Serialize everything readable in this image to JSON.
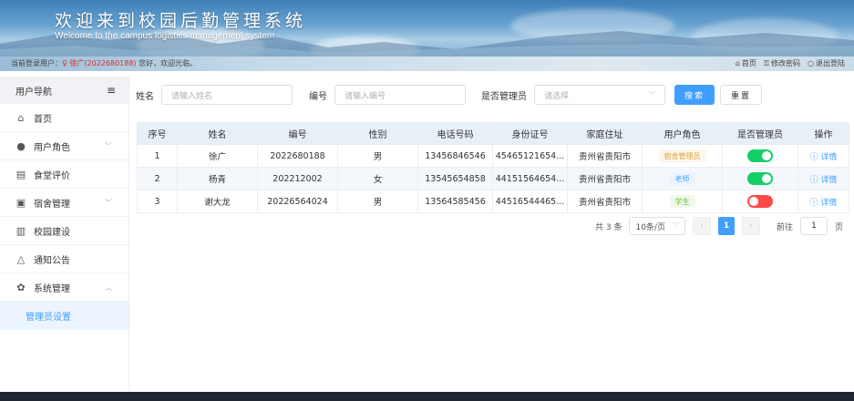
{
  "header": {
    "title": "欢迎来到校园后勤管理系统",
    "subtitle": "Welcome to the campus logistics management system"
  },
  "infobar": {
    "greeting_prefix": "当前登录用户：",
    "user": "徐广(2022680188)",
    "greeting_suffix": " 您好，欢迎光临。",
    "home": "首页",
    "change_password": "修改密码",
    "logout": "退出登陆"
  },
  "sidebar": {
    "title": "用户导航",
    "items": [
      {
        "label": "首页",
        "icon": "home-icon",
        "expandable": false
      },
      {
        "label": "用户角色",
        "icon": "user-icon",
        "expandable": true
      },
      {
        "label": "食堂评价",
        "icon": "document-icon",
        "expandable": false
      },
      {
        "label": "宿舍管理",
        "icon": "building-icon",
        "expandable": true
      },
      {
        "label": "校园建设",
        "icon": "office-icon",
        "expandable": false
      },
      {
        "label": "通知公告",
        "icon": "bell-icon",
        "expandable": false
      },
      {
        "label": "系统管理",
        "icon": "gear-icon",
        "expandable": true,
        "expanded": true
      }
    ],
    "sub_item": "管理员设置"
  },
  "filters": {
    "name_label": "姓名",
    "name_placeholder": "请输入姓名",
    "code_label": "编号",
    "code_placeholder": "请输入编号",
    "admin_label": "是否管理员",
    "admin_placeholder": "请选择",
    "search_button": "搜索",
    "reset_button": "重置"
  },
  "table": {
    "columns": [
      "序号",
      "姓名",
      "编号",
      "性别",
      "电话号码",
      "身份证号",
      "家庭住址",
      "用户角色",
      "是否管理员",
      "操作"
    ],
    "rows": [
      {
        "index": "1",
        "name": "徐广",
        "code": "2022680188",
        "gender": "男",
        "phone": "13456846546",
        "id_card": "45465121654...",
        "address": "贵州省贵阳市",
        "role": "宿舍管理员",
        "role_color": "#e6a23c",
        "role_bg": "#fdf6ec",
        "is_admin": true,
        "action": "详情"
      },
      {
        "index": "2",
        "name": "杨青",
        "code": "202212002",
        "gender": "女",
        "phone": "13545654858",
        "id_card": "44151564654...",
        "address": "贵州省贵阳市",
        "role": "老师",
        "role_color": "#409eff",
        "role_bg": "#ecf5ff",
        "is_admin": true,
        "action": "详情"
      },
      {
        "index": "3",
        "name": "谢大龙",
        "code": "20226564024",
        "gender": "男",
        "phone": "13564585456",
        "id_card": "44516544465...",
        "address": "贵州省贵阳市",
        "role": "学生",
        "role_color": "#67c23a",
        "role_bg": "#f0f9eb",
        "is_admin": false,
        "action": "详情"
      }
    ]
  },
  "colors": {
    "toggle_on": "#13ce66",
    "toggle_off": "#ff4949",
    "accent": "#409eff"
  },
  "pagination": {
    "total": "共 3 条",
    "page_size": "10条/页",
    "current_page": "1",
    "goto_label": "前往",
    "goto_value": "1",
    "page_label": "页"
  }
}
